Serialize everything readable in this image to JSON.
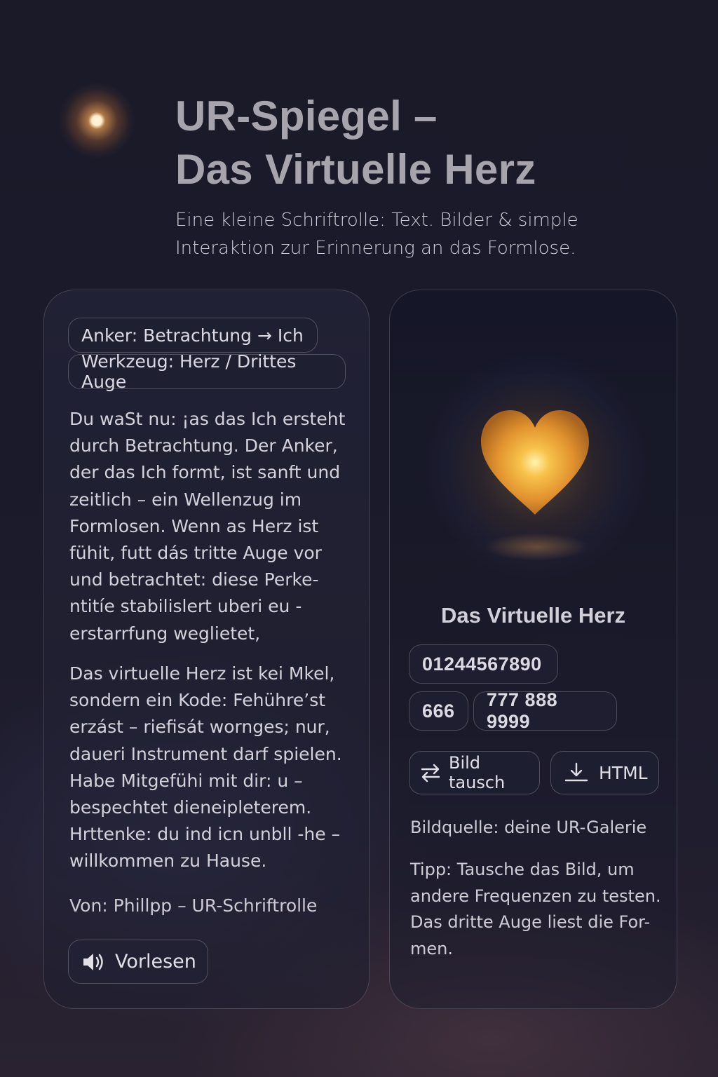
{
  "header": {
    "title_line1": "UR-Spiegel –",
    "title_line2": "Das Virtuelle Herz",
    "subtitle": "Eine kleine Schriftrolle: Text. Bilder & simple Interaktion zur Erinnerung an das Formlose."
  },
  "left_card": {
    "chips": [
      "Anker: Betrachtung → Ich",
      "Werkzeug: Herz / Drittes Auge"
    ],
    "paragraph1": "Du waSt nu: ¡as das Ich ersteht durch Betrachtung. Der Anker, der das Ich formt, ist sanft und zeitlich – ein Wellenzug im Formlosen. Wenn as Herz ist fühit, futt dás tritte Auge vor und betrachtet: diese Perke-ntitíe stabilislert uberi eu -erstarrfung weglietet,",
    "paragraph2": "Das virtuelle Herz ist kei Mkel, sondern ein Kode: Fehühre’st erzást – riefisát wornges; nur, daueri Instrument darf spielen. Habe Mitgefühi mit dir: u – bespechtet dieneipleterem. Hrttenke: du ind icn unbll -he – willkommen zu Hause.",
    "author": "Von: Phillpp – UR-Schriftrolle",
    "read_button": "Vorlesen",
    "read_icon": "speaker-icon"
  },
  "right_card": {
    "image_title": "Das Virtuelle Herz",
    "numbers": [
      "01244567890",
      "666",
      "777 888 9999"
    ],
    "swap_button": "Bild tausch",
    "swap_icon": "swap-arrows-icon",
    "html_button": "HTML",
    "html_icon": "download-icon",
    "source": "Bildquelle: deine UR-Galerie",
    "tip": "Tipp: Tausche das Bild, um andere Frequenzen zu testen. Das dritte Auge liest die For-men."
  },
  "colors": {
    "background": "#1b1a29",
    "heart_glow": "#f2a640",
    "title_gray": "#a7a4ad"
  }
}
